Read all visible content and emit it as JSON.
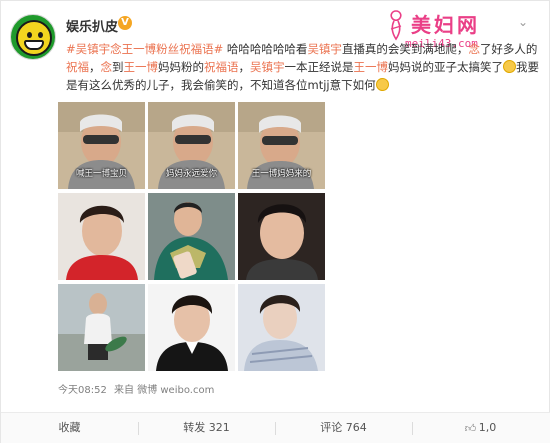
{
  "header": {
    "username": "娱乐扒皮",
    "verified_badge": "V",
    "dropdown_icon": "chevron-down-icon"
  },
  "watermark": {
    "title": "美妇网",
    "url": "meili43.com"
  },
  "post": {
    "segments": [
      {
        "text": "#吴镇宇念王一博粉丝祝福语#",
        "link": true
      },
      {
        "text": " 哈哈哈哈哈哈看",
        "link": false
      },
      {
        "text": "吴镇宇",
        "link": true
      },
      {
        "text": "直播真的会笑到满地爬，",
        "link": false
      },
      {
        "text": "念",
        "link": true
      },
      {
        "text": "了好多人的",
        "link": false
      },
      {
        "text": "祝福",
        "link": true
      },
      {
        "text": "，",
        "link": false
      },
      {
        "text": "念",
        "link": true
      },
      {
        "text": "到",
        "link": false
      },
      {
        "text": "王一博",
        "link": true
      },
      {
        "text": "妈妈粉的",
        "link": false
      },
      {
        "text": "祝福语",
        "link": true
      },
      {
        "text": "，",
        "link": false
      },
      {
        "text": "吴镇宇",
        "link": true
      },
      {
        "text": "一本正经说是",
        "link": false
      },
      {
        "text": "王一博",
        "link": true
      },
      {
        "text": "妈妈说的亚子太搞笑了",
        "link": false
      },
      {
        "text": "我要是有这么优秀的儿子，我会偷笑的，不知道各位mtjj意下如何",
        "link": false
      }
    ]
  },
  "images": {
    "captions": [
      "喊王一博宝贝",
      "妈妈永远爱你",
      "王一博妈妈来的"
    ]
  },
  "meta": {
    "time": "今天08:52",
    "source_prefix": "来自",
    "source": "微博 weibo.com"
  },
  "actions": {
    "favorite": "收藏",
    "repost": "转发 321",
    "comment": "评论 764",
    "like": "1,0"
  },
  "colors": {
    "link": "#eb7350",
    "watermark": "#ea3f87"
  }
}
